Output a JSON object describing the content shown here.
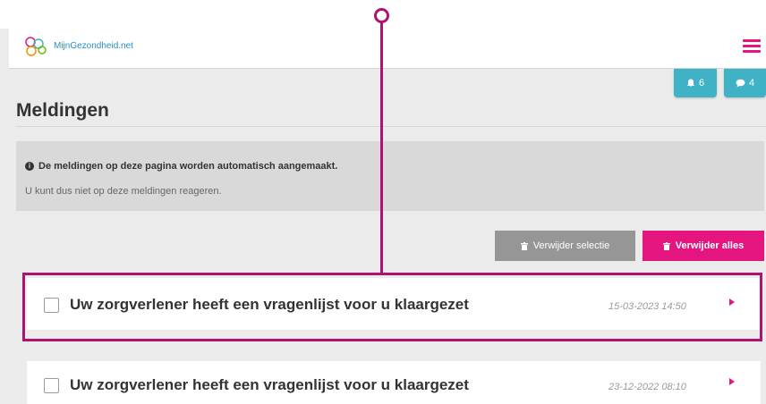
{
  "header": {
    "logo_text": "MijnGezondheid.net",
    "brand_color": "#e5157f",
    "accent_color": "#3fb2c6"
  },
  "badges": [
    {
      "icon": "bell-icon",
      "count": "6"
    },
    {
      "icon": "chat-bubble-icon",
      "count": "4"
    }
  ],
  "page": {
    "title": "Meldingen"
  },
  "info": {
    "icon": "info-icon",
    "line1": "De meldingen op deze pagina worden automatisch aangemaakt.",
    "line2": "U kunt dus niet op deze meldingen reageren."
  },
  "actions": {
    "delete_selection": "Verwijder selectie",
    "delete_all": "Verwijder alles"
  },
  "notifications": [
    {
      "text": "Uw zorgverlener heeft een vragenlijst voor u klaargezet",
      "date": "15-03-2023 14:50",
      "checked": false
    },
    {
      "text": "Uw zorgverlener heeft een vragenlijst voor u klaargezet",
      "date": "23-12-2022 08:10",
      "checked": false
    }
  ]
}
